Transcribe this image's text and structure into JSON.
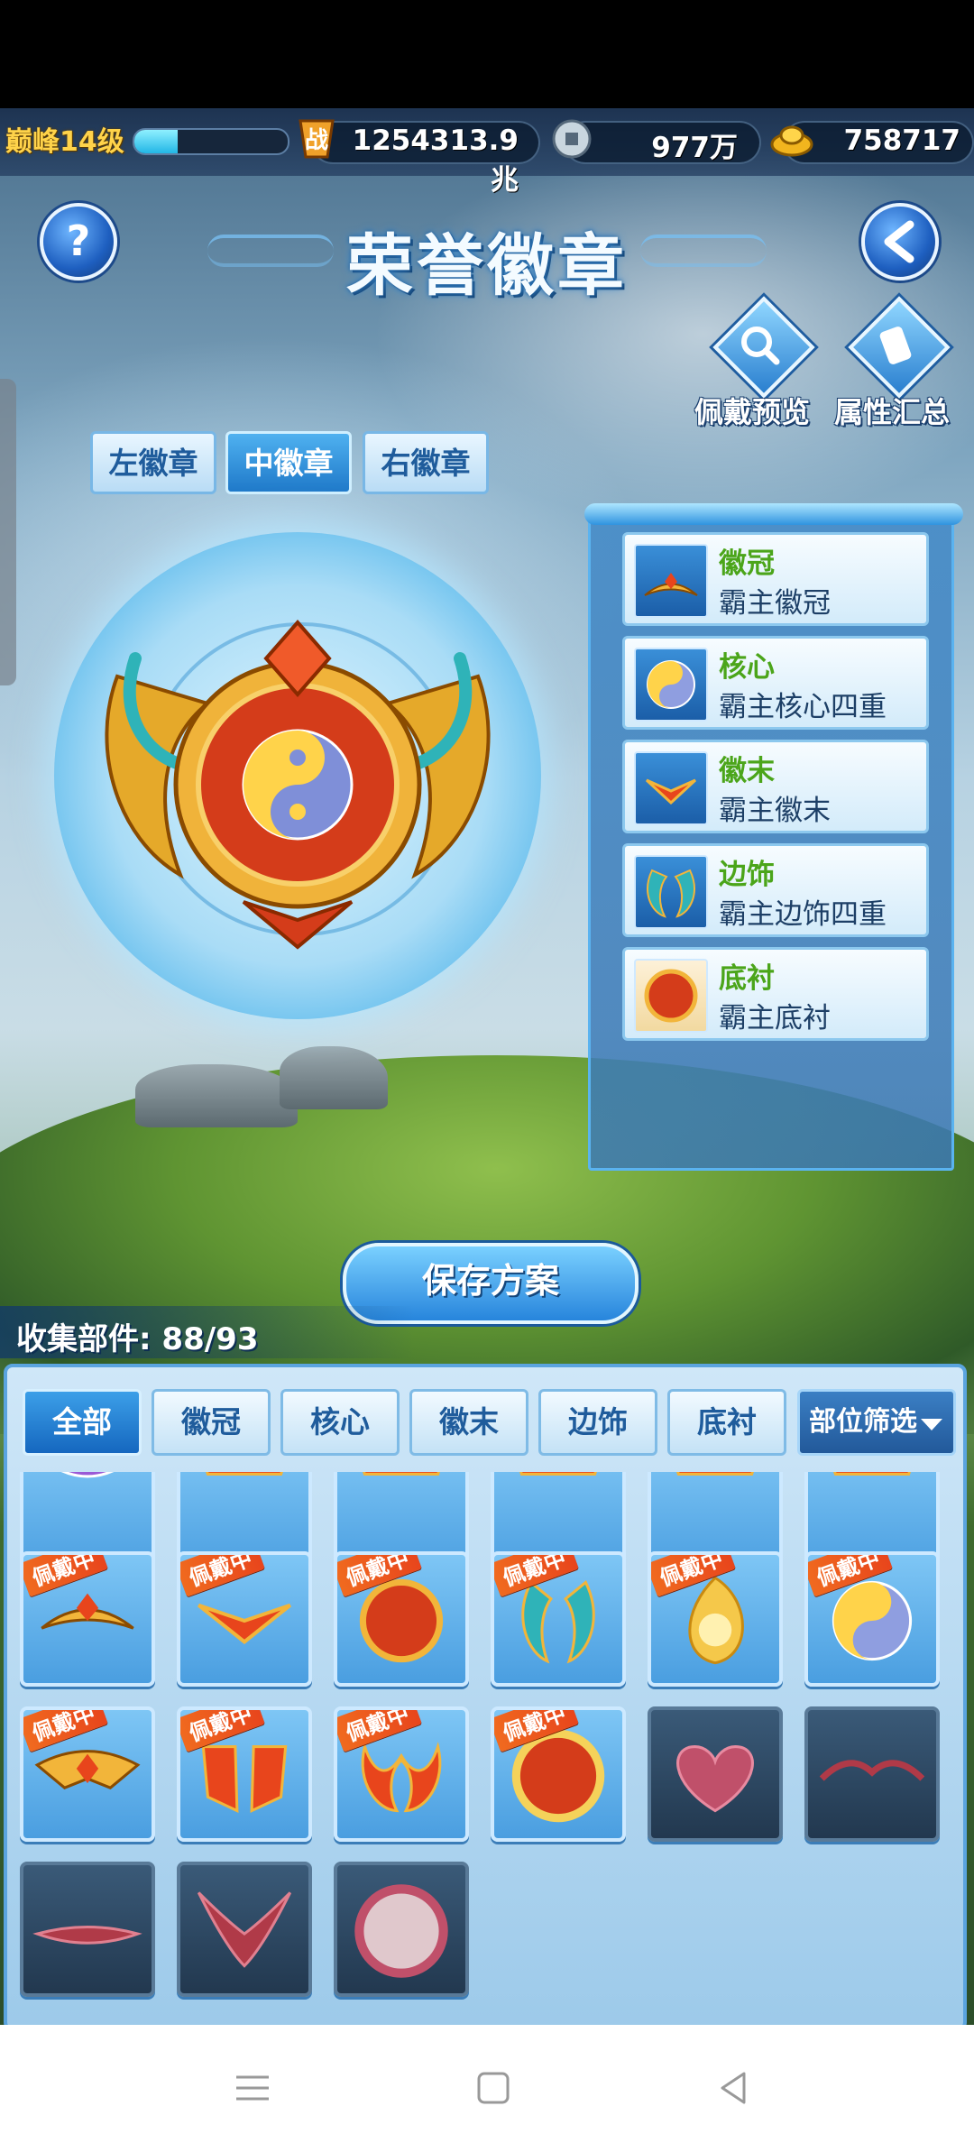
{
  "topbar": {
    "level": "巅峰14级",
    "exp_progress": 0.28,
    "combat_power": "1254313.9兆",
    "silver": "977万",
    "gold": "758717",
    "icons": [
      "battle-icon",
      "coin-icon",
      "gold-ingot-icon"
    ]
  },
  "page": {
    "title": "荣誉徽章"
  },
  "actions": {
    "wear_preview": "佩戴预览",
    "attr_summary": "属性汇总"
  },
  "badge_tabs": [
    "左徽章",
    "中徽章",
    "右徽章"
  ],
  "active_badge_tab": 1,
  "parts": [
    {
      "category": "徽冠",
      "name": "霸主徽冠"
    },
    {
      "category": "核心",
      "name": "霸主核心四重"
    },
    {
      "category": "徽末",
      "name": "霸主徽末"
    },
    {
      "category": "边饰",
      "name": "霸主边饰四重"
    },
    {
      "category": "底衬",
      "name": "霸主底衬"
    }
  ],
  "save_button": "保存方案",
  "collection": "收集部件: 88/93",
  "filter_tabs": [
    "全部",
    "徽冠",
    "核心",
    "徽末",
    "边饰",
    "底衬"
  ],
  "active_filter": 0,
  "filter_select": "部位筛选",
  "equipped_tag": "佩戴中",
  "colors": {
    "accent": "#2785dc",
    "equipped_tag": "#e8451c",
    "category_text": "#4ba51a"
  }
}
